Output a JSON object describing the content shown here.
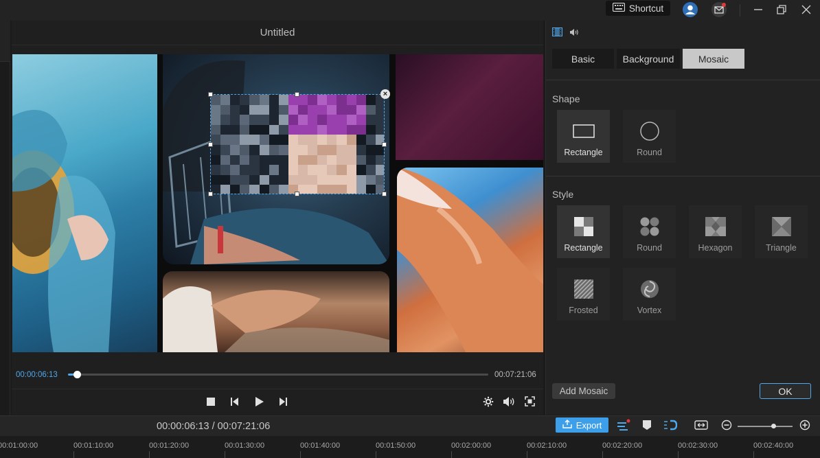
{
  "titlebar": {
    "shortcut_label": "Shortcut",
    "icons": [
      "keyboard-icon",
      "user-icon",
      "mail-icon",
      "minimize-icon",
      "restore-icon",
      "close-icon"
    ]
  },
  "preview": {
    "title": "Untitled",
    "current_time": "00:00:06:13",
    "total_time": "00:07:21:06",
    "progress": 0.022
  },
  "panel": {
    "tabs": [
      {
        "label": "Basic",
        "active": false
      },
      {
        "label": "Background",
        "active": false
      },
      {
        "label": "Mosaic",
        "active": true
      }
    ],
    "shape_label": "Shape",
    "shapes": [
      {
        "label": "Rectangle",
        "selected": true,
        "icon": "rectangle-outline-icon"
      },
      {
        "label": "Round",
        "selected": false,
        "icon": "circle-outline-icon"
      }
    ],
    "style_label": "Style",
    "styles": [
      {
        "label": "Rectangle",
        "selected": true,
        "icon": "rectangle-mosaic-icon"
      },
      {
        "label": "Round",
        "selected": false,
        "icon": "round-mosaic-icon"
      },
      {
        "label": "Hexagon",
        "selected": false,
        "icon": "hexagon-mosaic-icon"
      },
      {
        "label": "Triangle",
        "selected": false,
        "icon": "triangle-mosaic-icon"
      },
      {
        "label": "Frosted",
        "selected": false,
        "icon": "frosted-mosaic-icon"
      },
      {
        "label": "Vortex",
        "selected": false,
        "icon": "vortex-mosaic-icon"
      }
    ],
    "add_mosaic_label": "Add Mosaic",
    "ok_label": "OK"
  },
  "bottom": {
    "time_display": "00:00:06:13 / 00:07:21:06",
    "export_label": "Export",
    "zoom_level": 0.65
  },
  "ruler": [
    "00:01:00:00",
    "00:01:10:00",
    "00:01:20:00",
    "00:01:30:00",
    "00:01:40:00",
    "00:01:50:00",
    "00:02:00:00",
    "00:02:10:00",
    "00:02:20:00",
    "00:02:30:00",
    "00:02:40:00"
  ],
  "colors": {
    "accent": "#4fa9ec",
    "export": "#3d9fea",
    "background": "#1b1b1b"
  }
}
